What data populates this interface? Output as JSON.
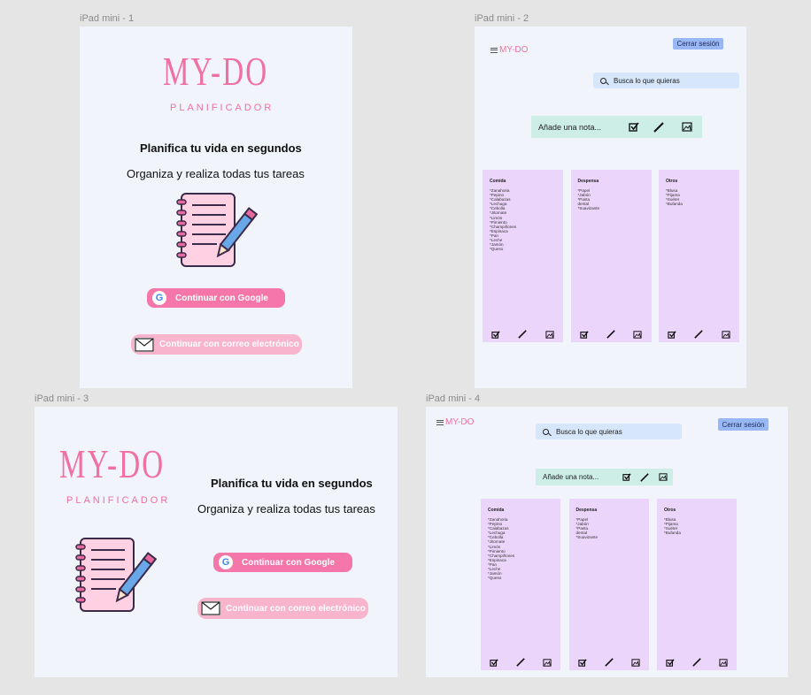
{
  "frames": {
    "f1": "iPad mini - 1",
    "f2": "iPad mini - 2",
    "f3": "iPad mini - 3",
    "f4": "iPad mini - 4"
  },
  "landing": {
    "brand": "MY-DO",
    "subtitle": "PLANIFICADOR",
    "headline": "Planifica tu vida en segundos",
    "tagline": "Organiza y realiza todas tus tareas",
    "google_label": "Continuar con Google",
    "mail_label": "Continuar con correo electrónico"
  },
  "app": {
    "brand": "MY-DO",
    "logout_label": "Cerrar sesión",
    "search_placeholder": "Busca lo que quieras",
    "note_placeholder": "Añade una nota...",
    "columns": [
      {
        "title": "Comida",
        "items": [
          "*Zanahoria",
          "*Pepino",
          "*Calabazas",
          "*Lechuga",
          "*Cebolla",
          "*Jitomate",
          "*Limón",
          "*Pimiento",
          "*Champiñones",
          "*Espinaca",
          "*Pan",
          "*Leche",
          "*Jamón",
          "*Queso"
        ]
      },
      {
        "title": "Despensa",
        "items": [
          "*Papel",
          "*Jabón",
          "*Pasta",
          "dental",
          "*Suavizante"
        ]
      },
      {
        "title": "Otros",
        "items": [
          "*Blusa",
          "*Pijama",
          "*Suéter",
          "*Bufanda"
        ]
      }
    ]
  },
  "colors": {
    "brand_pink": "#f06fa4",
    "google_button": "#f576a8",
    "mail_button": "#f8b4cd",
    "note_bar": "#cdeee6",
    "search": "#d6e6fb",
    "column": "#ecd5fb",
    "logout": "#9ab7f5"
  },
  "icons": {
    "google": "google-g-icon",
    "mail": "envelope-icon",
    "check": "checkbox-icon",
    "pen": "pen-icon",
    "image": "image-icon",
    "search": "search-icon",
    "menu": "hamburger-icon",
    "notebook": "notebook-pencil-illustration"
  }
}
